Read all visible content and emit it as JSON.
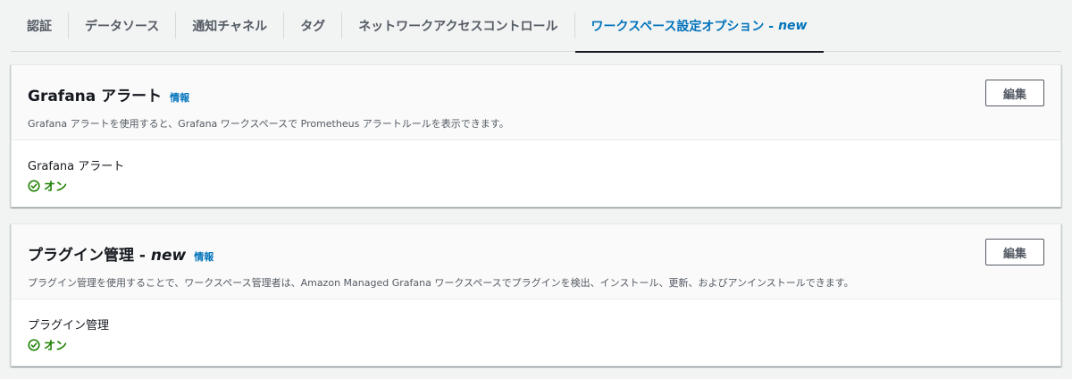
{
  "tabs": [
    {
      "label": "認証",
      "new": ""
    },
    {
      "label": "データソース",
      "new": ""
    },
    {
      "label": "通知チャネル",
      "new": ""
    },
    {
      "label": "タグ",
      "new": ""
    },
    {
      "label": "ネットワークアクセスコントロール",
      "new": ""
    },
    {
      "label": "ワークスペース設定オプション -",
      "new": "new",
      "active": true
    }
  ],
  "panels": [
    {
      "title": "Grafana アラート",
      "title_new": "",
      "info": "情報",
      "description": "Grafana アラートを使用すると、Grafana ワークスペースで Prometheus アラートルールを表示できます。",
      "edit_label": "編集",
      "field_label": "Grafana アラート",
      "status": "オン"
    },
    {
      "title": "プラグイン管理 -",
      "title_new": "new",
      "info": "情報",
      "description": "プラグイン管理を使用することで、ワークスペース管理者は、Amazon Managed Grafana ワークスペースでプラグインを検出、インストール、更新、およびアンインストールできます。",
      "edit_label": "編集",
      "field_label": "プラグイン管理",
      "status": "オン"
    }
  ],
  "colors": {
    "accent": "#0073bb",
    "success": "#1d8102",
    "text": "#16191f",
    "muted": "#545b64"
  },
  "icons": {
    "status": "check-circle-icon"
  }
}
